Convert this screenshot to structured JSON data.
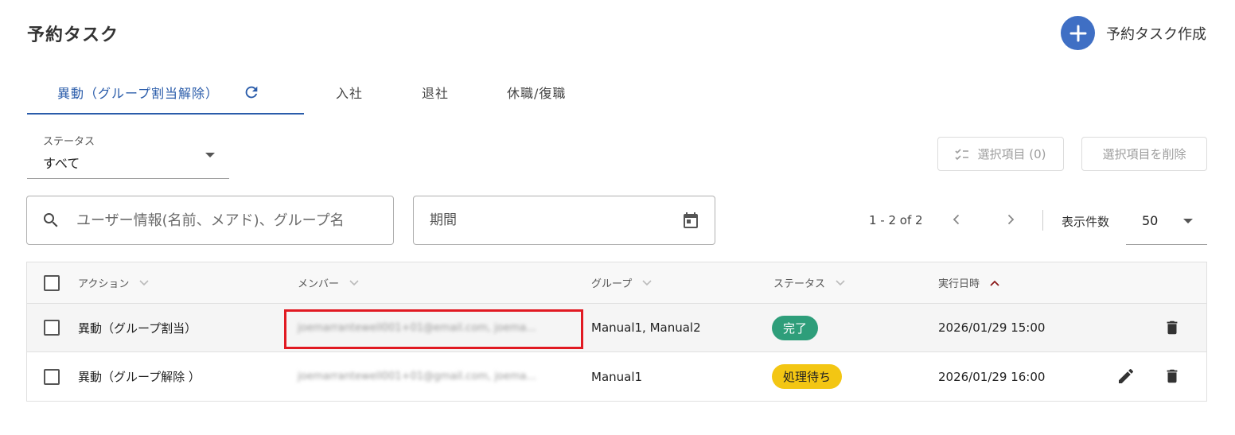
{
  "page": {
    "title": "予約タスク"
  },
  "create_button": {
    "label": "予約タスク作成",
    "icon": "plus-icon"
  },
  "tabs": [
    {
      "label": "異動（グループ割当解除）",
      "active": true
    },
    {
      "label": "入社",
      "active": false
    },
    {
      "label": "退社",
      "active": false
    },
    {
      "label": "休職/復職",
      "active": false
    }
  ],
  "filter": {
    "status_label": "ステータス",
    "status_value": "すべて"
  },
  "actions": {
    "selected_label": "選択項目 (0)",
    "delete_selected_label": "選択項目を削除"
  },
  "search": {
    "placeholder": "ユーザー情報(名前、メアド)、グループ名"
  },
  "period": {
    "placeholder": "期間"
  },
  "pagination": {
    "range": "1 - 2 of 2",
    "page_size_label": "表示件数",
    "page_size": "50"
  },
  "table": {
    "columns": [
      "アクション",
      "メンバー",
      "グループ",
      "ステータス",
      "実行日時"
    ],
    "rows": [
      {
        "action": "異動（グループ割当）",
        "member": "joemarrantewell001+01@email.com, joema...",
        "group": "Manual1, Manual2",
        "status": "完了",
        "datetime": "2026/01/29 15:00"
      },
      {
        "action": "異動（グループ解除 ）",
        "member": "joemarrantewell001+01@gmail.com, joema...",
        "group": "Manual1",
        "status": "処理待ち",
        "datetime": "2026/01/29 16:00"
      }
    ]
  },
  "colors": {
    "accent": "#2a5caa",
    "fab": "#3f6fc4",
    "done": "#2e9e7a",
    "waiting": "#f3c613",
    "highlight": "#e11a22"
  }
}
